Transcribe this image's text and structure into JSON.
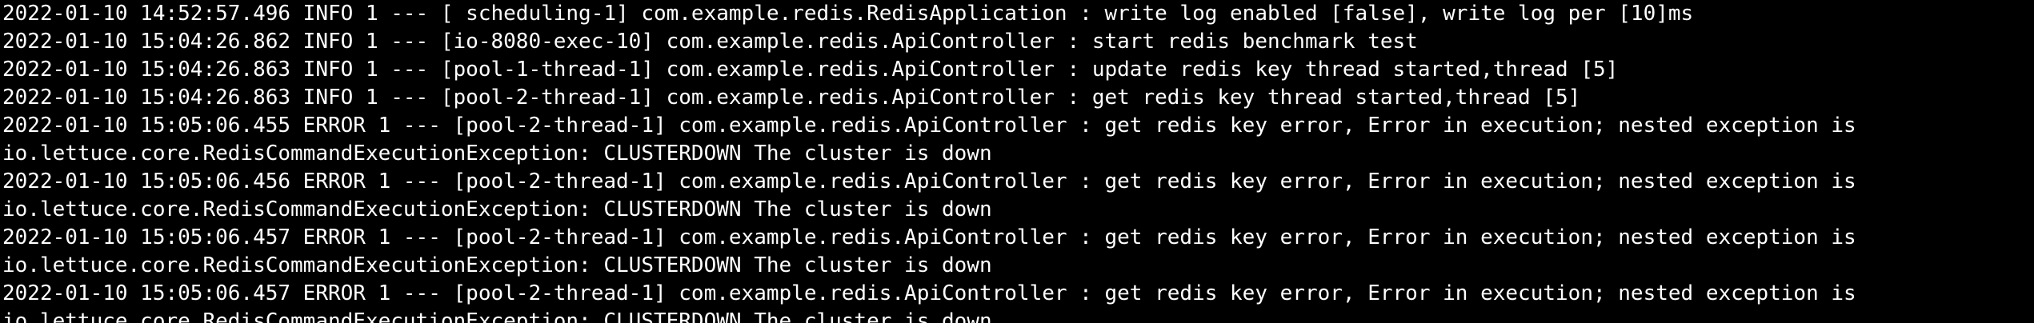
{
  "terminal": {
    "lines": [
      "2022-01-10 14:52:57.496 INFO 1 --- [ scheduling-1] com.example.redis.RedisApplication : write log enabled [false], write log per [10]ms",
      "2022-01-10 15:04:26.862 INFO 1 --- [io-8080-exec-10] com.example.redis.ApiController : start redis benchmark test",
      "2022-01-10 15:04:26.863 INFO 1 --- [pool-1-thread-1] com.example.redis.ApiController : update redis key thread started,thread [5]",
      "2022-01-10 15:04:26.863 INFO 1 --- [pool-2-thread-1] com.example.redis.ApiController : get redis key thread started,thread [5]",
      "2022-01-10 15:05:06.455 ERROR 1 --- [pool-2-thread-1] com.example.redis.ApiController : get redis key error, Error in execution; nested exception is",
      "io.lettuce.core.RedisCommandExecutionException: CLUSTERDOWN The cluster is down",
      "2022-01-10 15:05:06.456 ERROR 1 --- [pool-2-thread-1] com.example.redis.ApiController : get redis key error, Error in execution; nested exception is",
      "io.lettuce.core.RedisCommandExecutionException: CLUSTERDOWN The cluster is down",
      "2022-01-10 15:05:06.457 ERROR 1 --- [pool-2-thread-1] com.example.redis.ApiController : get redis key error, Error in execution; nested exception is",
      "io.lettuce.core.RedisCommandExecutionException: CLUSTERDOWN The cluster is down",
      "2022-01-10 15:05:06.457 ERROR 1 --- [pool-2-thread-1] com.example.redis.ApiController : get redis key error, Error in execution; nested exception is",
      "io.lettuce.core.RedisCommandExecutionException: CLUSTERDOWN The cluster is down"
    ]
  }
}
